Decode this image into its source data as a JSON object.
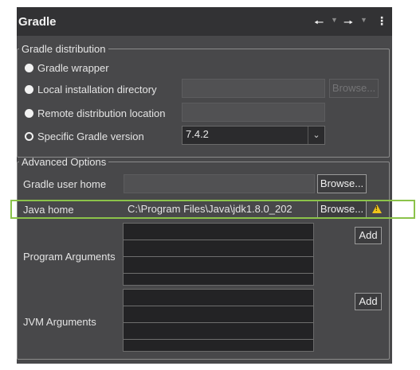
{
  "window": {
    "title": "Gradle",
    "toolbar": {
      "back_icon": "arrow-left-icon",
      "forward_icon": "arrow-right-icon",
      "menu_icon": "kebab-menu-icon"
    }
  },
  "distribution": {
    "legend": "Gradle distribution",
    "options": [
      {
        "label": "Gradle wrapper",
        "selected": false
      },
      {
        "label": "Local installation directory",
        "selected": false
      },
      {
        "label": "Remote distribution location",
        "selected": false
      },
      {
        "label": "Specific Gradle version",
        "selected": true
      }
    ],
    "local_dir_value": "",
    "local_browse_label": "Browse...",
    "remote_location_value": "",
    "version_value": "7.4.2"
  },
  "advanced": {
    "legend": "Advanced Options",
    "user_home_label": "Gradle user home",
    "user_home_value": "",
    "user_home_browse": "Browse...",
    "java_home_label": "Java home",
    "java_home_value": "C:\\Program Files\\Java\\jdk1.8.0_202",
    "java_home_browse": "Browse...",
    "warning_icon": "warning-icon",
    "program_args_label": "Program Arguments",
    "program_args_add": "Add",
    "jvm_args_label": "JVM Arguments",
    "jvm_args_add": "Add"
  },
  "colors": {
    "highlight": "#8bc34a",
    "warning": "#f0c419",
    "panel": "#48484a"
  }
}
